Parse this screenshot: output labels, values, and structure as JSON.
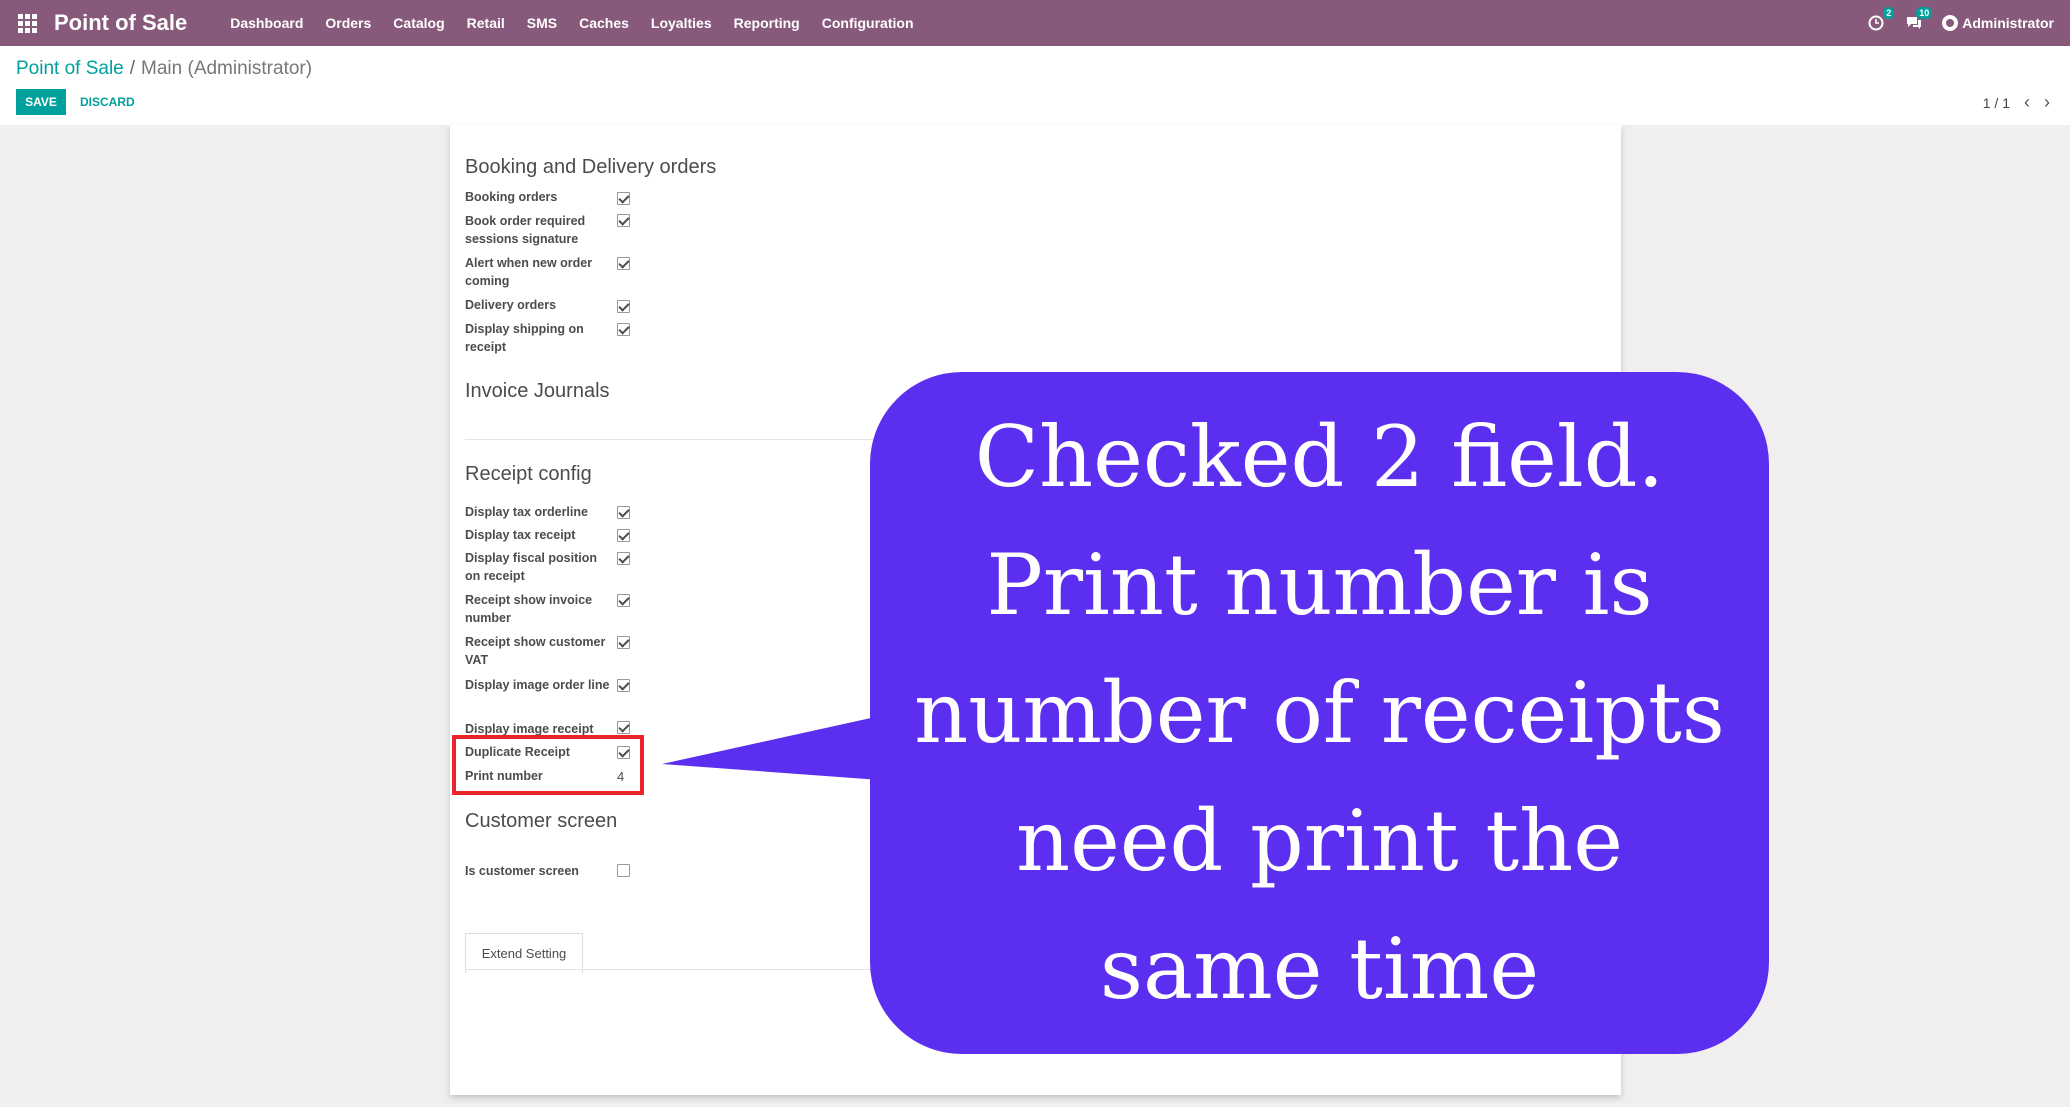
{
  "navbar": {
    "brand": "Point of Sale",
    "menu": [
      "Dashboard",
      "Orders",
      "Catalog",
      "Retail",
      "SMS",
      "Caches",
      "Loyalties",
      "Reporting",
      "Configuration"
    ],
    "activity_badge": "2",
    "messages_badge": "10",
    "user": "Administrator",
    "color": "#875a7b"
  },
  "control": {
    "breadcrumb_root": "Point of Sale",
    "breadcrumb_sep": "/",
    "breadcrumb_current": "Main (Administrator)",
    "save_label": "SAVE",
    "discard_label": "DISCARD",
    "pager": "1 / 1",
    "accent": "#00a09d"
  },
  "sections": {
    "booking": {
      "title": "Booking and Delivery orders",
      "fields": [
        {
          "label": "Booking orders",
          "checked": true
        },
        {
          "label": "Book order required sessions signature",
          "checked": true
        },
        {
          "label": "Alert when new order coming",
          "checked": true
        },
        {
          "label": "Delivery orders",
          "checked": true
        },
        {
          "label": "Display shipping on receipt",
          "checked": true
        }
      ]
    },
    "invoice": {
      "title": "Invoice Journals"
    },
    "receipt": {
      "title": "Receipt config",
      "fields": [
        {
          "label": "Display tax orderline",
          "checked": true
        },
        {
          "label": "Display tax receipt",
          "checked": true
        },
        {
          "label": "Display fiscal position on receipt",
          "checked": true
        },
        {
          "label": "Receipt show invoice number",
          "checked": true
        },
        {
          "label": "Receipt show customer VAT",
          "checked": true
        },
        {
          "label": "Display image order line",
          "checked": true
        },
        {
          "label": "Display image receipt",
          "checked": true
        },
        {
          "label": "Duplicate Receipt",
          "checked": true
        }
      ],
      "print_number_label": "Print number",
      "print_number_value": "4"
    },
    "customer": {
      "title": "Customer screen",
      "fields": [
        {
          "label": "Is customer screen",
          "checked": false
        }
      ]
    }
  },
  "tabs": {
    "extend_setting": "Extend Setting"
  },
  "callout": {
    "text": "Checked 2 field. Print number is number of receipts need print the same time",
    "color": "#5b2ef0",
    "highlight_color": "#e8232a"
  }
}
